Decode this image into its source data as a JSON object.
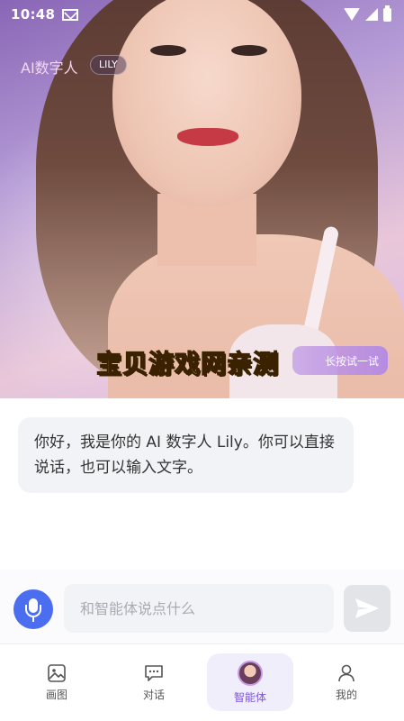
{
  "status_bar": {
    "time": "10:48"
  },
  "hero": {
    "title": "AI数字人",
    "badge": "LILY",
    "long_press_label": "长按试一试",
    "watermark": "宝贝游戏网亲测"
  },
  "chat": {
    "messages": [
      {
        "role": "assistant",
        "text": "你好，我是你的 AI 数字人 Lily。你可以直接说话，也可以输入文字。"
      }
    ]
  },
  "input": {
    "placeholder": "和智能体说点什么",
    "value": ""
  },
  "nav": {
    "items": [
      {
        "label": "画图",
        "icon": "image-icon",
        "active": false
      },
      {
        "label": "对话",
        "icon": "chat-icon",
        "active": false
      },
      {
        "label": "智能体",
        "icon": "avatar-icon",
        "active": true
      },
      {
        "label": "我的",
        "icon": "profile-icon",
        "active": false
      }
    ]
  },
  "colors": {
    "accent": "#4b6ef0",
    "nav_active_bg": "#f1eefc",
    "nav_active_text": "#7a55d6",
    "watermark": "#ffd23c"
  }
}
